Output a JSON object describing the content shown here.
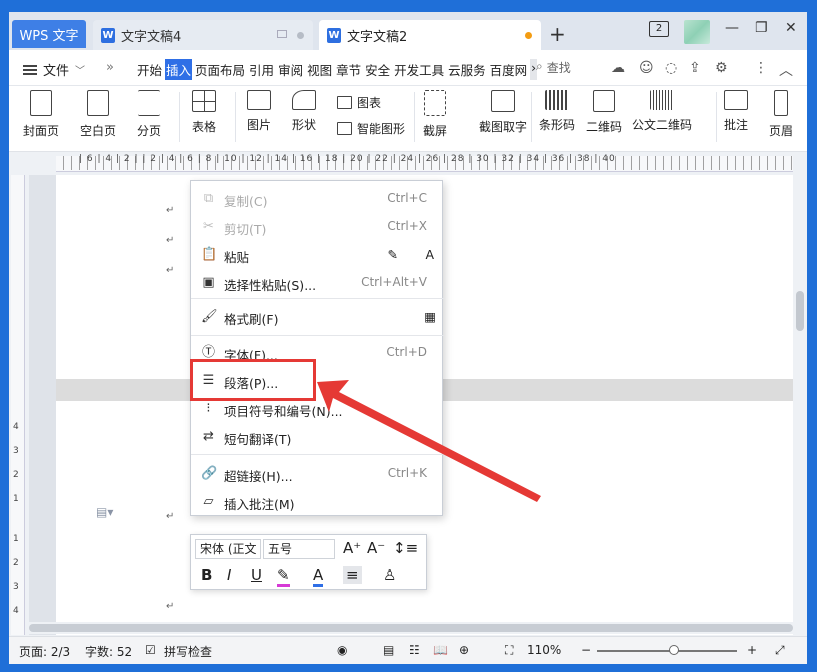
{
  "tabs": {
    "wps_label": "WPS 文字",
    "doc4_title": "文字文稿4",
    "doc2_title": "文字文稿2",
    "new_tab": "+",
    "page_badge": "2"
  },
  "menubar": {
    "file_label": "文件",
    "items": [
      "开始",
      "插入",
      "页面布局",
      "引用",
      "审阅",
      "视图",
      "章节",
      "安全",
      "开发工具",
      "云服务",
      "百度网"
    ],
    "active_item": "插入",
    "search_label": "查找"
  },
  "toolbar": {
    "cover": "封面页",
    "blank": "空白页",
    "page_break": "分页",
    "table": "表格",
    "picture": "图片",
    "shape": "形状",
    "chart": "图表",
    "smart_art": "智能图形",
    "screenshot": "截屏",
    "screenshot_ocr": "截图取字",
    "barcode": "条形码",
    "qrcode": "二维码",
    "pdf417": "公文二维码",
    "comment": "批注",
    "header": "页眉"
  },
  "ruler": {
    "numbers": "| 6 | 4 | 2 |    | 2 | 4 | 6 | 8 | 10 | 12 | 14 | 16 | 18 | 20 | 22 | 24 | 26 | 28 | 30 | 32 | 34 | 36 | 38 | 40"
  },
  "left_ruler": [
    "4",
    "3",
    "2",
    "1",
    "1",
    "2",
    "3",
    "4"
  ],
  "context_menu": {
    "items": [
      {
        "label": "复制(C)",
        "shortcut": "Ctrl+C",
        "icon": "copy-icon",
        "disabled": true
      },
      {
        "label": "剪切(T)",
        "shortcut": "Ctrl+X",
        "icon": "scissors-icon",
        "disabled": true
      },
      {
        "label": "粘贴",
        "shortcut": "",
        "icon": "paste-icon",
        "disabled": false
      },
      {
        "label": "选择性粘贴(S)...",
        "shortcut": "Ctrl+Alt+V",
        "icon": "paste-special-icon",
        "disabled": false
      },
      {
        "label": "格式刷(F)",
        "shortcut": "",
        "icon": "format-brush-icon",
        "disabled": false
      },
      {
        "label": "字体(F)...",
        "shortcut": "Ctrl+D",
        "icon": "font-icon",
        "disabled": false
      },
      {
        "label": "段落(P)...",
        "shortcut": "",
        "icon": "paragraph-icon",
        "disabled": false
      },
      {
        "label": "项目符号和编号(N)...",
        "shortcut": "",
        "icon": "bullets-icon",
        "disabled": false
      },
      {
        "label": "短句翻译(T)",
        "shortcut": "",
        "icon": "translate-icon",
        "disabled": false
      },
      {
        "label": "超链接(H)...",
        "shortcut": "Ctrl+K",
        "icon": "link-icon",
        "disabled": false
      },
      {
        "label": "插入批注(M)",
        "shortcut": "",
        "icon": "comment-icon",
        "disabled": false
      }
    ]
  },
  "mini_toolbar": {
    "font_name": "宋体 (正文",
    "font_size": "五号",
    "bold": "B",
    "italic": "I",
    "underline": "U"
  },
  "statusbar": {
    "page": "页面: 2/3",
    "words": "字数: 52",
    "spellcheck": "拼写检查",
    "zoom": "110%"
  },
  "colors": {
    "accent": "#2f6fe6",
    "highlight": "#e53935",
    "tab_active": "#3e7fe6"
  }
}
